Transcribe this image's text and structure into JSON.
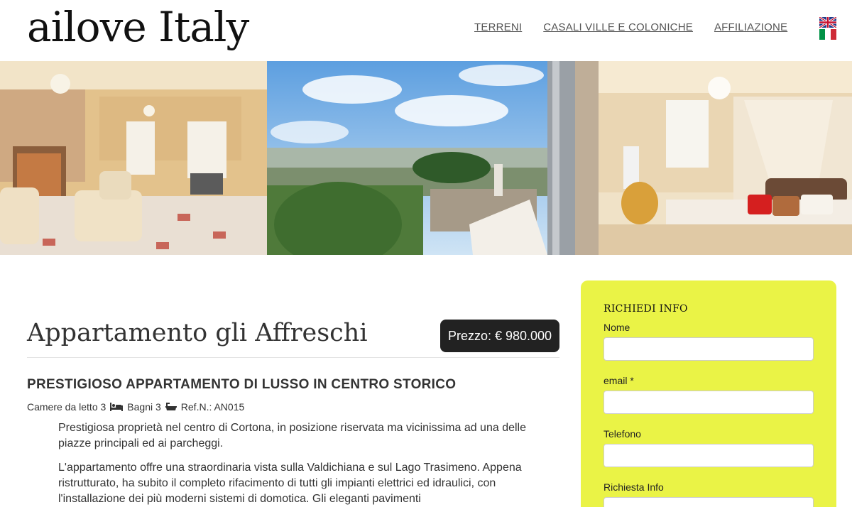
{
  "site": {
    "logo": "ailove Italy"
  },
  "nav": {
    "items": [
      {
        "label": "TERRENI"
      },
      {
        "label": "CASALI VILLE E COLONICHE"
      },
      {
        "label": "AFFILIAZIONE"
      }
    ]
  },
  "listing": {
    "title": "Appartamento gli Affreschi",
    "price": "Prezzo: € 980.000",
    "subtitle": "PRESTIGIOSO APPARTAMENTO DI LUSSO IN CENTRO STORICO",
    "bedrooms": "Camere da letto 3",
    "bathrooms": "Bagni 3",
    "ref": "Ref.N.: AN015",
    "description": [
      "Prestigiosa proprietà nel centro di Cortona, in posizione riservata ma vicinissima ad una delle piazze principali ed ai parcheggi.",
      "L'appartamento offre una straordinaria vista sulla Valdichiana e sul Lago Trasimeno. Appena ristrutturato, ha subito il completo rifacimento di tutti gli impianti elettrici ed idraulici, con l'installazione dei più moderni sistemi di domotica. Gli eleganti pavimenti"
    ]
  },
  "form": {
    "title": "RICHIEDI INFO",
    "name_label": "Nome",
    "email_label": "email *",
    "phone_label": "Telefono",
    "request_label": "Richiesta Info"
  },
  "colors": {
    "form_bg": "#eaf346",
    "price_bg": "#222222"
  }
}
